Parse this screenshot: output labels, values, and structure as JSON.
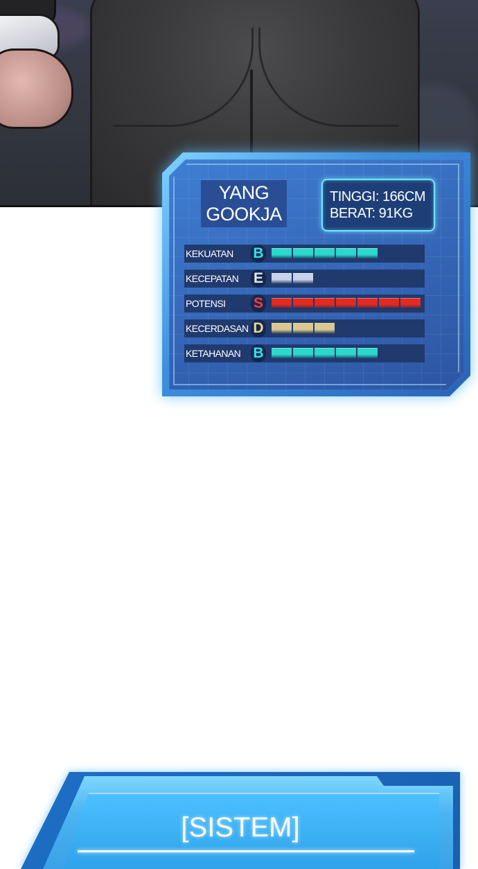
{
  "profile": {
    "name_line1": "YANG",
    "name_line2": "GOOKJA",
    "height": "TINGGI: 166CM",
    "weight": "BERAT: 91KG"
  },
  "stats": [
    {
      "label": "KEKUATAN",
      "grade": "B",
      "grade_color": "#33e1e8",
      "segments": 5,
      "bar_color": "#2ad8cc"
    },
    {
      "label": "KECEPATAN",
      "grade": "E",
      "grade_color": "#e6e8f2",
      "segments": 2,
      "bar_color": "#c9d2ea"
    },
    {
      "label": "POTENSI",
      "grade": "S",
      "grade_color": "#ff3b3b",
      "segments": 7,
      "bar_color": "#e02a22"
    },
    {
      "label": "KECERDASAN",
      "grade": "D",
      "grade_color": "#e8d79a",
      "segments": 3,
      "bar_color": "#d9c98c"
    },
    {
      "label": "KETAHANAN",
      "grade": "B",
      "grade_color": "#33e1e8",
      "segments": 5,
      "bar_color": "#2ad8cc"
    }
  ],
  "system_panel": {
    "title": "[SISTEM]"
  }
}
